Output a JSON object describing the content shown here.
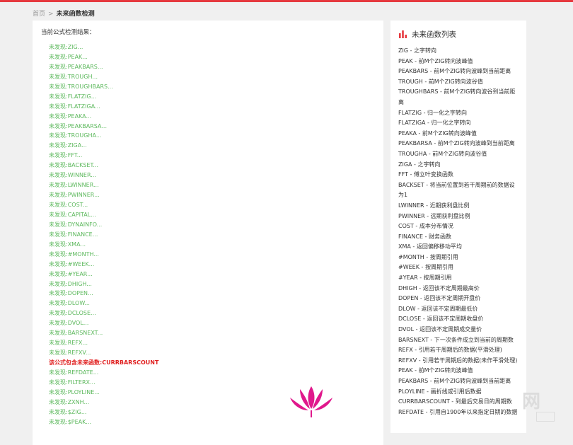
{
  "breadcrumb": {
    "home": "首页",
    "separator": ">",
    "current": "未来函数检测"
  },
  "main": {
    "heading": "当前公式检测结果：",
    "results": [
      {
        "text": "未发现:ZIG...",
        "status": "ok"
      },
      {
        "text": "未发现:PEAK...",
        "status": "ok"
      },
      {
        "text": "未发现:PEAKBARS...",
        "status": "ok"
      },
      {
        "text": "未发现:TROUGH...",
        "status": "ok"
      },
      {
        "text": "未发现:TROUGHBARS...",
        "status": "ok"
      },
      {
        "text": "未发现:FLATZIG...",
        "status": "ok"
      },
      {
        "text": "未发现:FLATZIGA...",
        "status": "ok"
      },
      {
        "text": "未发现:PEAKA...",
        "status": "ok"
      },
      {
        "text": "未发现:PEAKBARSA...",
        "status": "ok"
      },
      {
        "text": "未发现:TROUGHA...",
        "status": "ok"
      },
      {
        "text": "未发现:ZIGA...",
        "status": "ok"
      },
      {
        "text": "未发现:FFT...",
        "status": "ok"
      },
      {
        "text": "未发现:BACKSET...",
        "status": "ok"
      },
      {
        "text": "未发现:WINNER...",
        "status": "ok"
      },
      {
        "text": "未发现:LWINNER...",
        "status": "ok"
      },
      {
        "text": "未发现:PWINNER...",
        "status": "ok"
      },
      {
        "text": "未发现:COST...",
        "status": "ok"
      },
      {
        "text": "未发现:CAPITAL...",
        "status": "ok"
      },
      {
        "text": "未发现:DYNAINFO...",
        "status": "ok"
      },
      {
        "text": "未发现:FINANCE...",
        "status": "ok"
      },
      {
        "text": "未发现:XMA...",
        "status": "ok"
      },
      {
        "text": "未发现:#MONTH...",
        "status": "ok"
      },
      {
        "text": "未发现:#WEEK...",
        "status": "ok"
      },
      {
        "text": "未发现:#YEAR...",
        "status": "ok"
      },
      {
        "text": "未发现:DHIGH...",
        "status": "ok"
      },
      {
        "text": "未发现:DOPEN...",
        "status": "ok"
      },
      {
        "text": "未发现:DLOW...",
        "status": "ok"
      },
      {
        "text": "未发现:DCLOSE...",
        "status": "ok"
      },
      {
        "text": "未发现:DVOL...",
        "status": "ok"
      },
      {
        "text": "未发现:BARSNEXT...",
        "status": "ok"
      },
      {
        "text": "未发现:REFX...",
        "status": "ok"
      },
      {
        "text": "未发现:REFXV...",
        "status": "ok"
      },
      {
        "text": "该公式包含未来函数:CURRBARSCOUNT",
        "status": "warn"
      },
      {
        "text": "未发现:REFDATE...",
        "status": "ok"
      },
      {
        "text": "未发现:FILTERX...",
        "status": "ok"
      },
      {
        "text": "未发现:PLOYLINE...",
        "status": "ok"
      },
      {
        "text": "未发现:ZXNH...",
        "status": "ok"
      },
      {
        "text": "未发现:$ZIG...",
        "status": "ok"
      },
      {
        "text": "未发现:$PEAK...",
        "status": "ok"
      }
    ]
  },
  "sidebar": {
    "title": "未来函数列表",
    "title_icon": "bar-chart-icon",
    "items": [
      "ZIG - 之字转向",
      "PEAK - 前M个ZIG转向波峰值",
      "PEAKBARS - 前M个ZIG转向波峰到当前距离",
      "TROUGH - 前M个ZIG转向波谷值",
      "TROUGHBARS - 前M个ZIG转向波谷到当前距离",
      "FLATZIG - 归一化之字转向",
      "FLATZIGA - 归一化之字转向",
      "PEAKA - 前M个ZIG转向波峰值",
      "PEAKBARSA - 前M个ZIG转向波峰到当前距离",
      "TROUGHA - 前M个ZIG转向波谷值",
      "ZIGA - 之字转向",
      "FFT - 傅立叶变换函数",
      "BACKSET - 将当前位置到若干周期前的数据设为1",
      "LWINNER - 近期获利盘比例",
      "PWINNER - 远期获利盘比例",
      "COST - 成本分布情况",
      "FINANCE - 财务函数",
      "XMA - 返回偏移移动平均",
      "#MONTH - 按周期引用",
      "#WEEK - 按周期引用",
      "#YEAR - 按周期引用",
      "DHIGH - 返回该不定周期最高价",
      "DOPEN - 返回该不定周期开盘价",
      "DLOW - 返回该不定周期最低价",
      "DCLOSE - 返回该不定周期收盘价",
      "DVOL - 返回该不定周期成交量价",
      "BARSNEXT - 下一次条件成立到当前的周期数",
      "REFX - 引用若干周期后的数据(平滑处理)",
      "REFXV - 引用若干周期后的数据(未作平滑处理)",
      "PEAK - 前M个ZIG转向波峰值",
      "PEAKBARS - 前M个ZIG转向波峰到当前距离",
      "PLOYLINE - 画折线或引用后数据",
      "CURRBARSCOUNT - 到最后交易日的周期数",
      "REFDATE - 引用自1900年以来指定日期的数据"
    ]
  },
  "watermark": {
    "net_text": "网",
    "box_text": ""
  },
  "colors": {
    "accent": "#e6393f",
    "ok": "#5cb85c",
    "warn": "#e02020",
    "logo": "#e0188c"
  }
}
